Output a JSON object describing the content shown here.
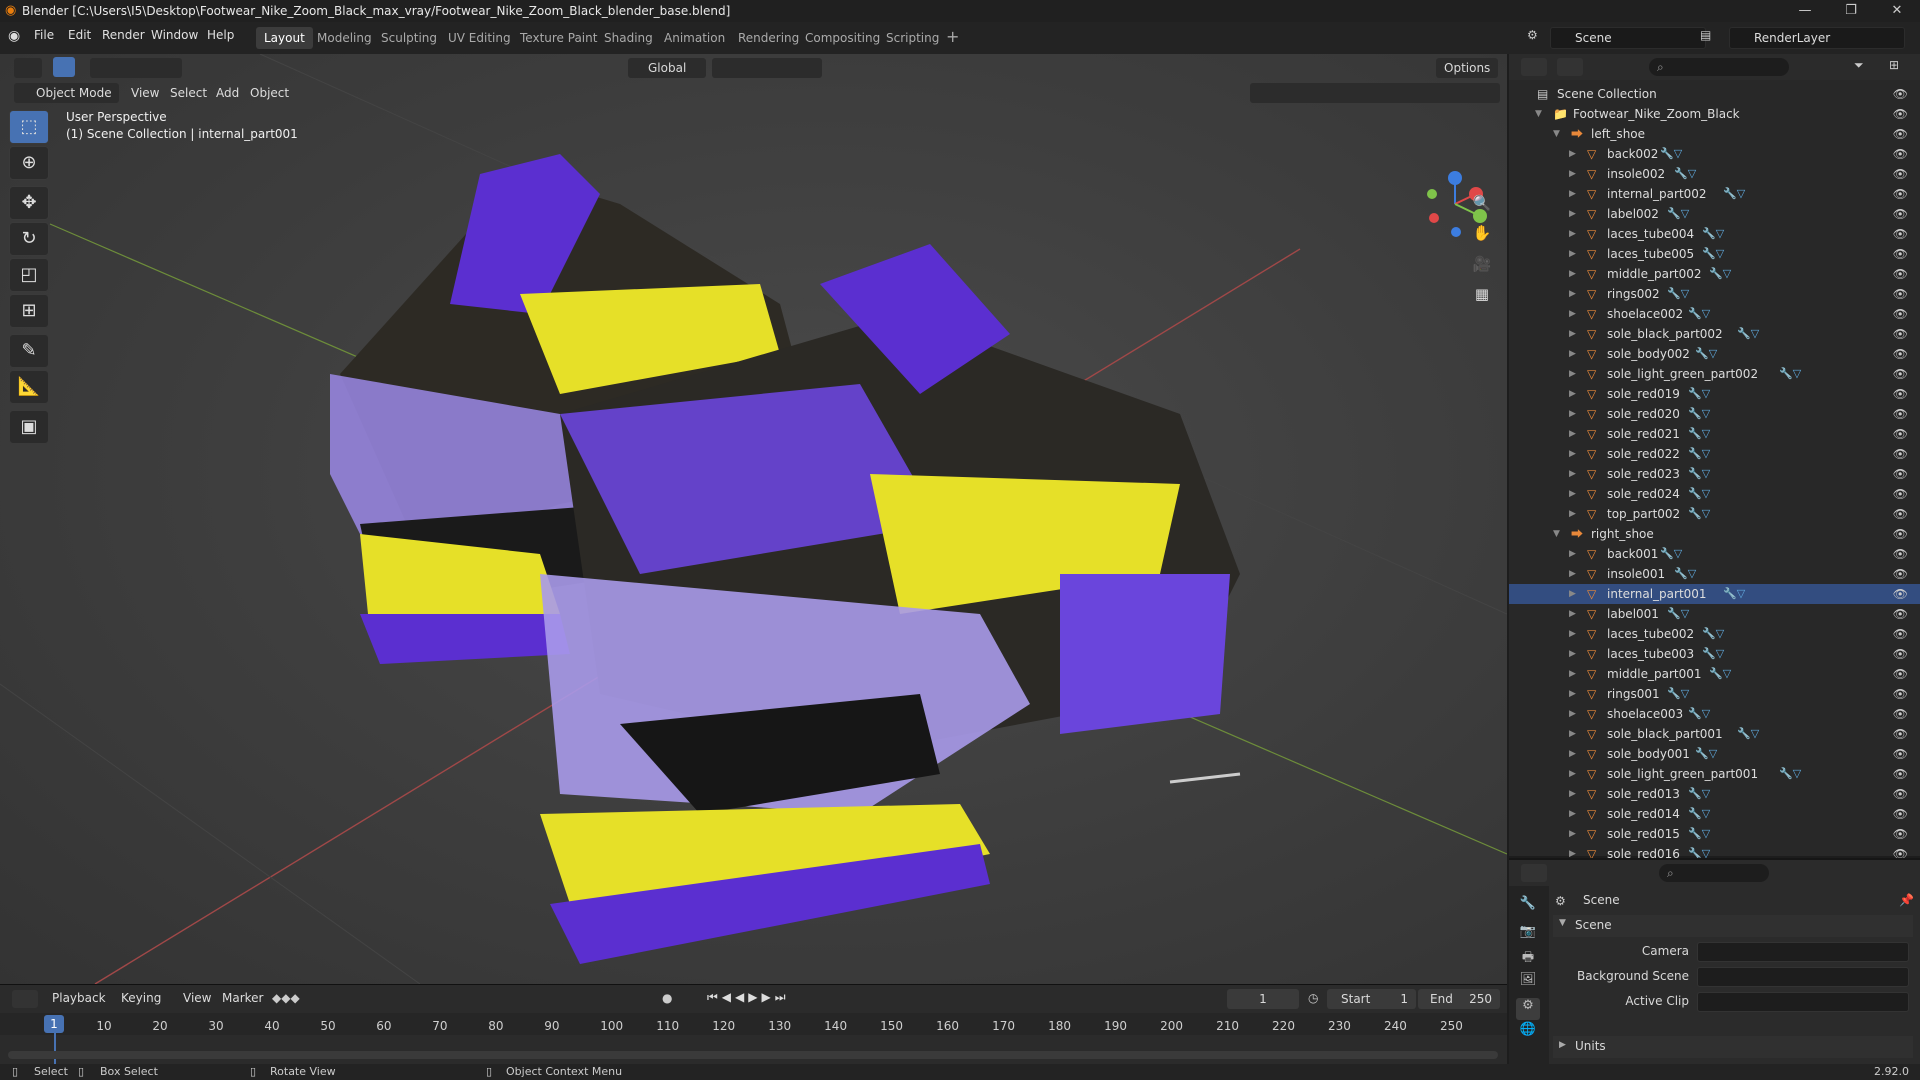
{
  "window": {
    "title": "Blender [C:\\Users\\I5\\Desktop\\Footwear_Nike_Zoom_Black_max_vray/Footwear_Nike_Zoom_Black_blender_base.blend]"
  },
  "menus": [
    "File",
    "Edit",
    "Render",
    "Window",
    "Help"
  ],
  "workspaces": [
    "Layout",
    "Modeling",
    "Sculpting",
    "UV Editing",
    "Texture Paint",
    "Shading",
    "Animation",
    "Rendering",
    "Compositing",
    "Scripting"
  ],
  "active_workspace": "Layout",
  "scene_field": "Scene",
  "view_layer_field": "RenderLayer",
  "transform_orientation": "Global",
  "options_label": "Options",
  "viewport": {
    "mode": "Object Mode",
    "menus": [
      "View",
      "Select",
      "Add",
      "Object"
    ],
    "overlay_title": "User Perspective",
    "overlay_sub": "(1) Scene Collection | internal_part001"
  },
  "outliner": {
    "root": "Scene Collection",
    "collection": "Footwear_Nike_Zoom_Black",
    "groups": [
      {
        "name": "left_shoe",
        "items": [
          "back002",
          "insole002",
          "internal_part002",
          "label002",
          "laces_tube004",
          "laces_tube005",
          "middle_part002",
          "rings002",
          "shoelace002",
          "sole_black_part002",
          "sole_body002",
          "sole_light_green_part002",
          "sole_red019",
          "sole_red020",
          "sole_red021",
          "sole_red022",
          "sole_red023",
          "sole_red024",
          "top_part002"
        ]
      },
      {
        "name": "right_shoe",
        "items": [
          "back001",
          "insole001",
          "internal_part001",
          "label001",
          "laces_tube002",
          "laces_tube003",
          "middle_part001",
          "rings001",
          "shoelace003",
          "sole_black_part001",
          "sole_body001",
          "sole_light_green_part001",
          "sole_red013",
          "sole_red014",
          "sole_red015",
          "sole_red016"
        ]
      }
    ],
    "selected": "internal_part001"
  },
  "properties": {
    "header": "Scene",
    "panel": "Scene",
    "fields": [
      {
        "label": "Camera",
        "value": ""
      },
      {
        "label": "Background Scene",
        "value": ""
      },
      {
        "label": "Active Clip",
        "value": ""
      }
    ],
    "units_panel": "Units"
  },
  "timeline": {
    "menus": [
      "Playback",
      "Keying",
      "View",
      "Marker"
    ],
    "current_frame": "1",
    "start_label": "Start",
    "start": "1",
    "end_label": "End",
    "end": "250",
    "ticks": [
      "1",
      "10",
      "20",
      "30",
      "40",
      "50",
      "60",
      "70",
      "80",
      "90",
      "100",
      "110",
      "120",
      "130",
      "140",
      "150",
      "160",
      "170",
      "180",
      "190",
      "200",
      "210",
      "220",
      "230",
      "240",
      "250"
    ]
  },
  "statusbar": {
    "select": "Select",
    "box_select": "Box Select",
    "rotate": "Rotate View",
    "context": "Object Context Menu",
    "version": "2.92.0"
  },
  "colors": {
    "accent": "#4772b3",
    "selected_row": "#334d80",
    "mesh_icon": "#e8883a",
    "modifier_icon": "#5fa8dc",
    "shoe_purple": "#5b2fd0",
    "shoe_yellow": "#e6e028"
  }
}
